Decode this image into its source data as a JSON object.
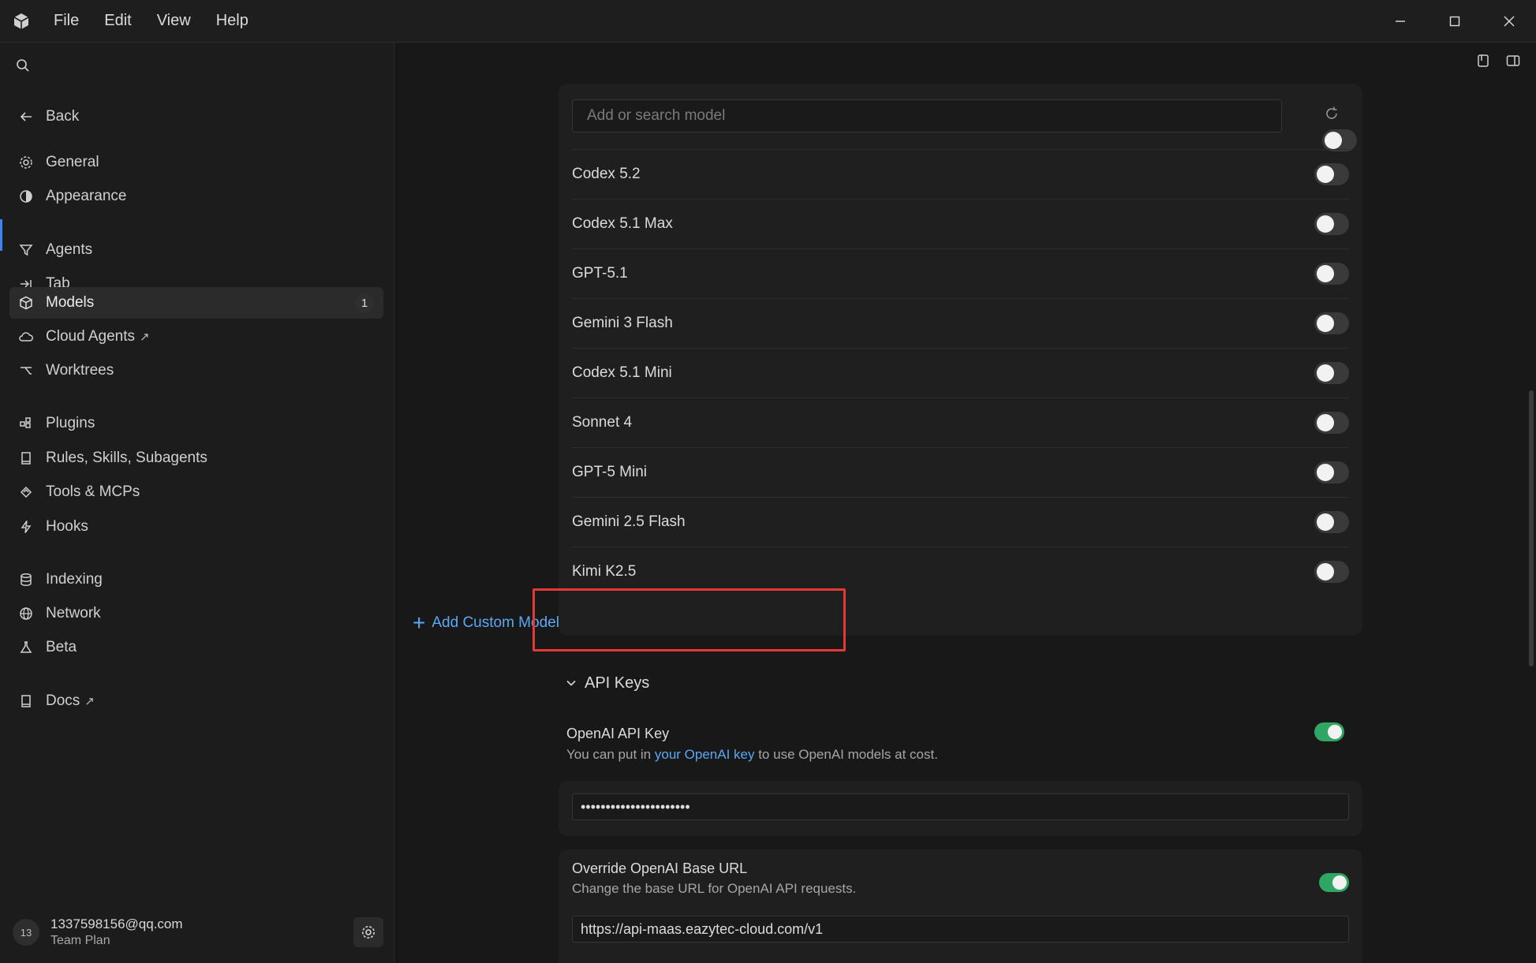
{
  "titlebar": {
    "menu": [
      "File",
      "Edit",
      "View",
      "Help"
    ]
  },
  "sidebar": {
    "back_label": "Back",
    "items": [
      {
        "label": "General",
        "icon": "gear-icon"
      },
      {
        "label": "Appearance",
        "icon": "palette-icon"
      },
      {
        "label": "Agents",
        "icon": "funnel-icon"
      },
      {
        "label": "Tab",
        "icon": "arrow-right-bar-icon"
      },
      {
        "label": "Models",
        "icon": "cube-icon",
        "badge": "1",
        "active": true
      },
      {
        "label": "Cloud Agents",
        "icon": "cloud-icon",
        "external": true
      },
      {
        "label": "Worktrees",
        "icon": "branch-icon"
      },
      {
        "label": "Plugins",
        "icon": "puzzle-icon"
      },
      {
        "label": "Rules, Skills, Subagents",
        "icon": "book-icon"
      },
      {
        "label": "Tools & MCPs",
        "icon": "tools-icon"
      },
      {
        "label": "Hooks",
        "icon": "bolt-icon"
      },
      {
        "label": "Indexing",
        "icon": "database-icon"
      },
      {
        "label": "Network",
        "icon": "globe-icon"
      },
      {
        "label": "Beta",
        "icon": "flask-icon"
      },
      {
        "label": "Docs",
        "icon": "book-icon",
        "external": true
      }
    ],
    "account": {
      "avatar_initials": "13",
      "email": "1337598156@qq.com",
      "plan": "Team Plan"
    }
  },
  "models": {
    "search_placeholder": "Add or search model",
    "list": [
      {
        "name": "Codex 5.2",
        "enabled": false
      },
      {
        "name": "Codex 5.1 Max",
        "enabled": false
      },
      {
        "name": "GPT-5.1",
        "enabled": false
      },
      {
        "name": "Gemini 3 Flash",
        "enabled": false
      },
      {
        "name": "Codex 5.1 Mini",
        "enabled": false
      },
      {
        "name": "Sonnet 4",
        "enabled": false
      },
      {
        "name": "GPT-5 Mini",
        "enabled": false
      },
      {
        "name": "Gemini 2.5 Flash",
        "enabled": false
      },
      {
        "name": "Kimi K2.5",
        "enabled": false
      }
    ],
    "add_custom_label": "Add Custom Model"
  },
  "api_keys": {
    "section_title": "API Keys",
    "openai": {
      "title": "OpenAI API Key",
      "desc_prefix": "You can put in ",
      "desc_link": "your OpenAI key",
      "desc_suffix": " to use OpenAI models at cost.",
      "enabled": true,
      "value": "••••••••••••••••••••••"
    },
    "base_url": {
      "title": "Override OpenAI Base URL",
      "desc": "Change the base URL for OpenAI API requests.",
      "enabled": true,
      "value": "https://api-maas.eazytec-cloud.com/v1"
    }
  },
  "colors": {
    "accent_blue": "#5aa9f5",
    "toggle_on": "#2fa664",
    "highlight_red": "#e53935"
  }
}
